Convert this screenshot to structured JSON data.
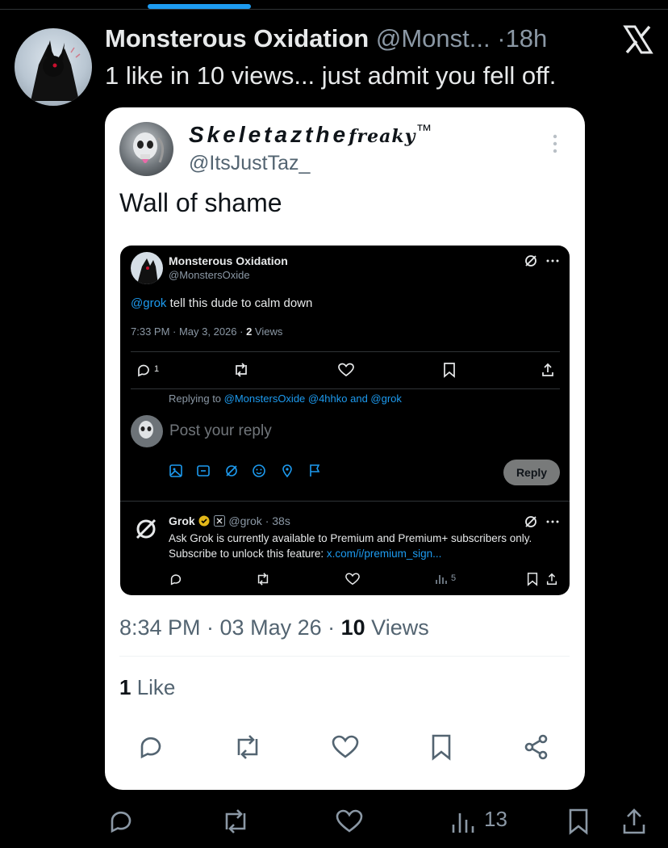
{
  "tweet": {
    "author_name": "Monsterous Oxidation",
    "author_handle": "@Monst...",
    "separator": "·",
    "time_ago": "18h",
    "text": "1 like in 10 views... just admit you fell off.",
    "views": "13"
  },
  "quoted": {
    "author_name": "Skeletazthe",
    "author_name_suffix": "freaky",
    "trademark": "™",
    "author_handle": "@ItsJustTaz_",
    "text": "Wall of shame",
    "timestamp": "8:34 PM · 03 May 26 · ",
    "view_count": "10",
    "view_label": " Views",
    "like_count": "1",
    "like_label": " Like"
  },
  "screenshot": {
    "author_name": "Monsterous Oxidation",
    "author_handle": "@MonstersOxide",
    "mention": "@grok",
    "text": " tell this dude to calm down",
    "meta": "7:33 PM · May 3, 2026 · ",
    "view_count": "2",
    "view_label": " Views",
    "reply_count": "1",
    "replying_prefix": "Replying to ",
    "replying_to": "@MonstersOxide @4hhko and @grok",
    "reply_placeholder": "Post your reply",
    "reply_button": "Reply",
    "grok_name": "Grok",
    "grok_handle": "@grok · 38s",
    "grok_text": "Ask Grok is currently available to Premium and Premium+ subscribers only. Subscribe to unlock this feature: ",
    "grok_link": "x.com/i/premium_sign...",
    "grok_views": "5"
  },
  "colors": {
    "accent": "#1d9bf0",
    "background": "#000000",
    "card": "#ffffff",
    "muted": "#8b98a5"
  }
}
